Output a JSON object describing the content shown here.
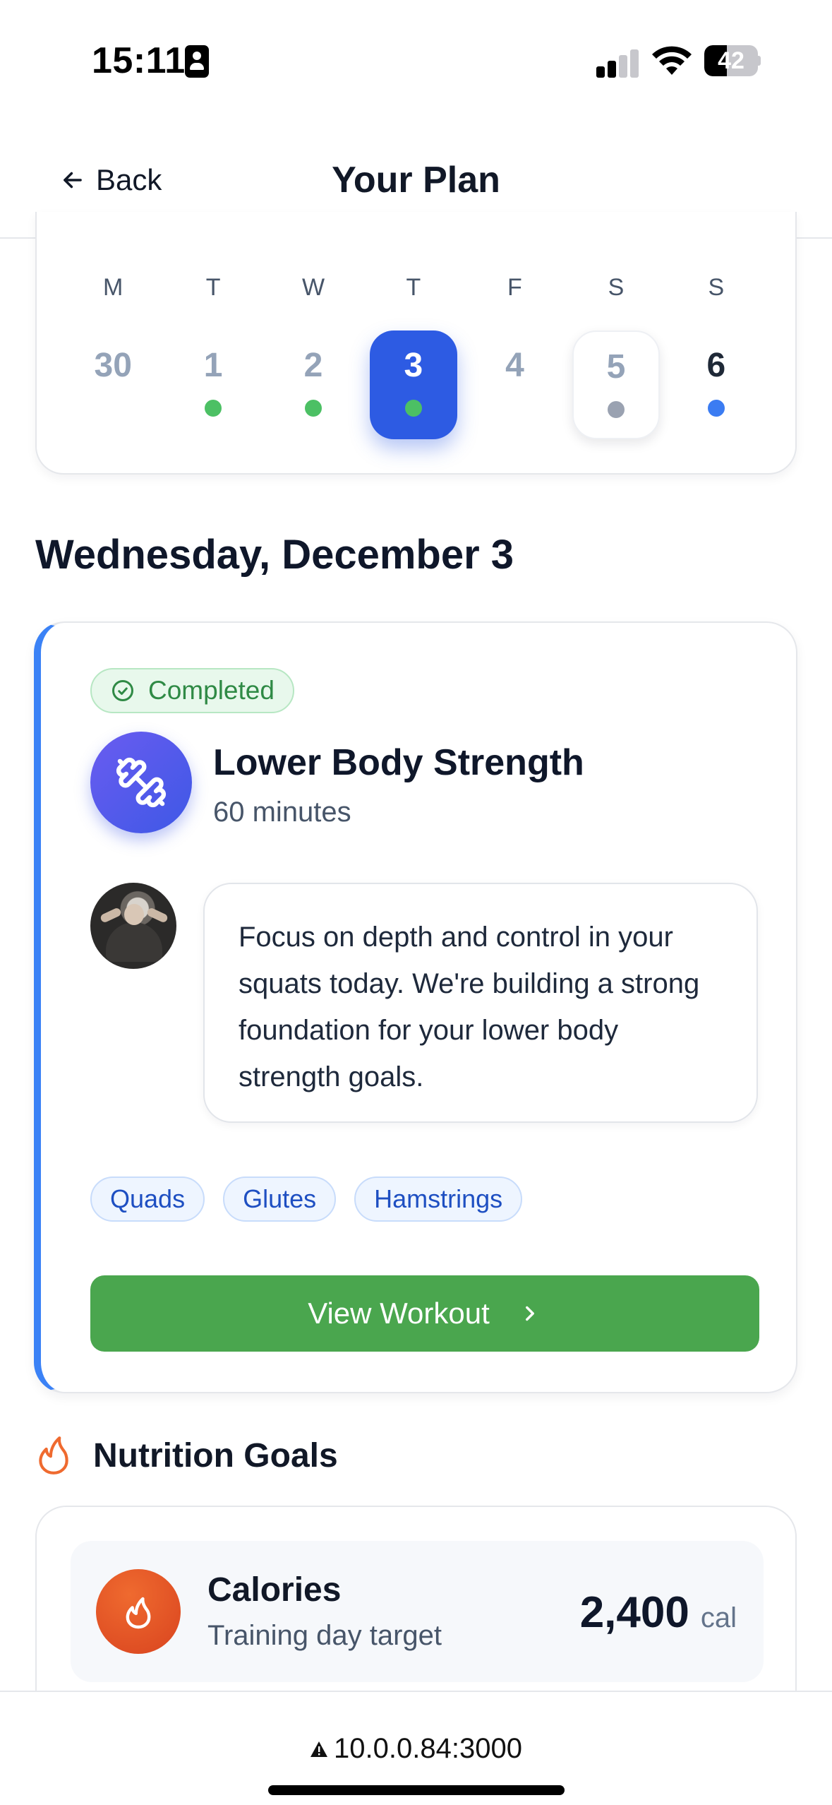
{
  "status_bar": {
    "time": "15:11",
    "battery_percent": "42",
    "battery_level": 0.42,
    "signal_bars_active": 2,
    "icons": [
      "contact-card-icon",
      "cellular-signal-icon",
      "wifi-icon",
      "battery-icon"
    ]
  },
  "header": {
    "back_label": "Back",
    "title": "Your Plan"
  },
  "week": {
    "days": [
      {
        "letter": "M",
        "date": "30",
        "dot": null,
        "state": "past"
      },
      {
        "letter": "T",
        "date": "1",
        "dot": "#4cc064",
        "state": "past"
      },
      {
        "letter": "W",
        "date": "2",
        "dot": "#4cc064",
        "state": "past"
      },
      {
        "letter": "T",
        "date": "3",
        "dot": "#4cc064",
        "state": "selected"
      },
      {
        "letter": "F",
        "date": "4",
        "dot": null,
        "state": "past"
      },
      {
        "letter": "S",
        "date": "5",
        "dot": "#9aa2b1",
        "state": "outlined"
      },
      {
        "letter": "S",
        "date": "6",
        "dot": "#3b7cf2",
        "state": "today"
      }
    ]
  },
  "date_heading": "Wednesday, December 3",
  "workout": {
    "status": "Completed",
    "title": "Lower Body Strength",
    "duration": "60 minutes",
    "coach_message": "Focus on depth and control in your squats today. We're building a strong foundation for your lower body strength goals.",
    "tags": [
      "Quads",
      "Glutes",
      "Hamstrings"
    ],
    "view_button": "View Workout",
    "icon": "dumbbell-icon"
  },
  "nutrition": {
    "title": "Nutrition Goals",
    "calories": {
      "label": "Calories",
      "sub": "Training day target",
      "value": "2,400",
      "unit": "cal"
    }
  },
  "browser": {
    "url": "10.0.0.84:3000"
  },
  "colors": {
    "accent_blue": "#2d5be3",
    "success_green": "#4aa64e",
    "completed_text": "#2f8a45",
    "calorie_orange": "#e5532a"
  }
}
